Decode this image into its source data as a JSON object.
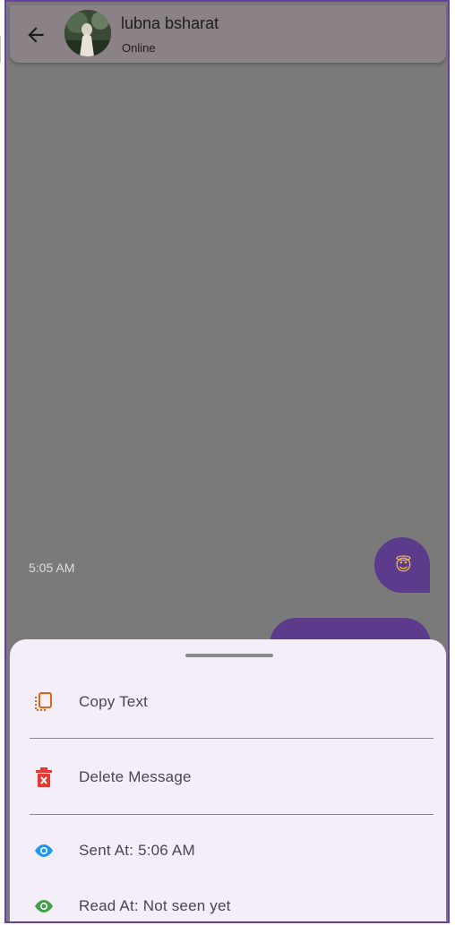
{
  "header": {
    "contact_name": "lubna bsharat",
    "status": "Online"
  },
  "chat": {
    "time_label": "5:05 AM",
    "emoji": "😇"
  },
  "sheet": {
    "items": [
      {
        "label": "Copy Text",
        "icon": "copy-icon",
        "color": "#e0651b"
      },
      {
        "label": "Delete Message",
        "icon": "trash-icon",
        "color": "#e53935"
      },
      {
        "label": "Sent At: 5:06 AM",
        "icon": "eye-icon",
        "color": "#2196f3"
      },
      {
        "label": "Read At: Not seen yet",
        "icon": "eye-icon",
        "color": "#43a047"
      }
    ]
  },
  "colors": {
    "accent": "#5c3a8c",
    "sheet_bg": "#f3eef8",
    "overlay": "#7a7a7a"
  }
}
